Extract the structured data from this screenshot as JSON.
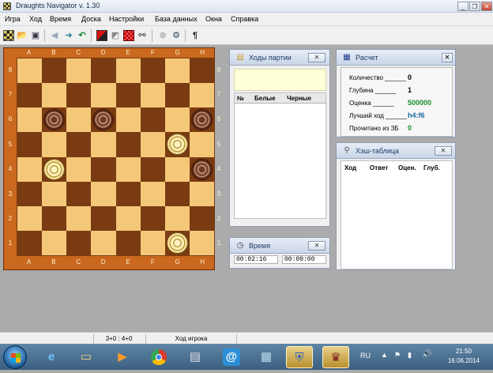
{
  "window": {
    "title": "Draughts Navigator v. 1.30",
    "minimize": "_",
    "restore": "❐",
    "close": "✕"
  },
  "menu": [
    "Игра",
    "Ход",
    "Время",
    "Доска",
    "Настройки",
    "База данных",
    "Окна",
    "Справка"
  ],
  "toolbar_icons": [
    "new-board-icon",
    "open-icon",
    "save-icon",
    "back-icon",
    "forward-icon",
    "undo-icon",
    "board-red-icon",
    "edit-icon",
    "grid-icon",
    "binoculars-icon",
    "stop-icon",
    "settings-icon",
    "help-icon"
  ],
  "board": {
    "files": [
      "A",
      "B",
      "C",
      "D",
      "E",
      "F",
      "G",
      "H"
    ],
    "ranks": [
      "8",
      "7",
      "6",
      "5",
      "4",
      "3",
      "2",
      "1"
    ],
    "colors": {
      "light": "#f4c878",
      "dark": "#7a3b12",
      "frame": "#c9681e"
    },
    "pieces": [
      {
        "square": "b6",
        "color": "black"
      },
      {
        "square": "d6",
        "color": "black"
      },
      {
        "square": "h6",
        "color": "black"
      },
      {
        "square": "g5",
        "color": "white"
      },
      {
        "square": "b4",
        "color": "white"
      },
      {
        "square": "h4",
        "color": "black"
      },
      {
        "square": "g1",
        "color": "white"
      }
    ]
  },
  "moves_panel": {
    "title": "Ходы партии",
    "close": "✕",
    "columns": [
      "№",
      "Белые",
      "Черные"
    ]
  },
  "time_panel": {
    "title": "Время",
    "close": "✕",
    "white_time": "00:02:16",
    "black_time": "00:00:00"
  },
  "calc_panel": {
    "title": "Расчет",
    "close": "✕",
    "rows": [
      {
        "label": "Количество ______",
        "value": "0"
      },
      {
        "label": "Глубина ______",
        "value": "1"
      },
      {
        "label": "Оценка ______",
        "value": "500000"
      },
      {
        "label": "Лучший ход ______",
        "value": "h4:f6"
      },
      {
        "label": "Прочитано из ЗБ",
        "value": "0"
      }
    ],
    "accent": "#1a8c2a",
    "best_move_color": "#1a6a9a"
  },
  "hash_panel": {
    "title": "Хэш-таблица",
    "close": "✕",
    "columns": [
      "Ход",
      "Ответ",
      "Оцен.",
      "Глуб."
    ]
  },
  "status": {
    "score": "3+0 : 4+0",
    "message": "Ход игрока"
  },
  "taskbar": {
    "apps": [
      "ie-icon",
      "explorer-icon",
      "media-player-icon",
      "chrome-icon",
      "document-icon",
      "mail-icon",
      "control-panel-icon",
      "security-icon",
      "draughts-app-icon"
    ],
    "language": "RU",
    "time": "21:50",
    "date": "16.06.2014"
  }
}
